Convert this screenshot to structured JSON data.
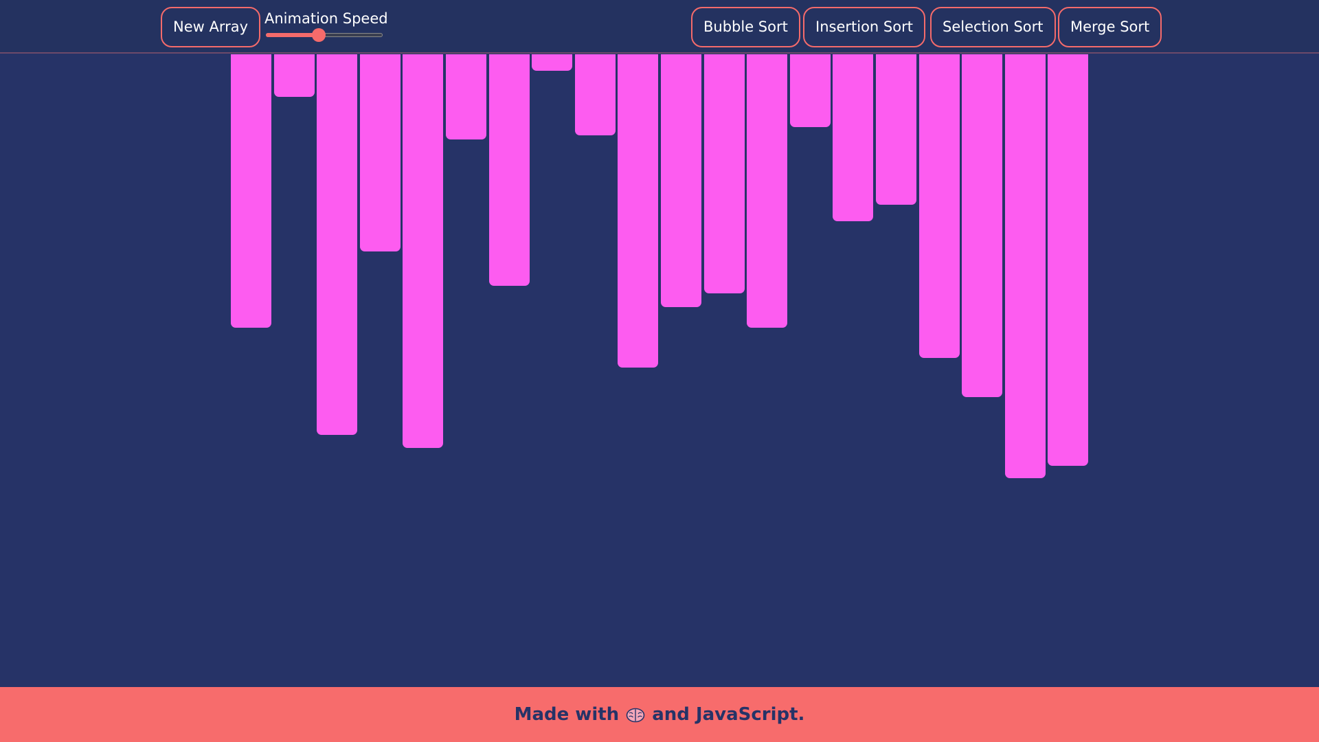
{
  "navbar": {
    "new_array_label": "New Array",
    "speed_label": "Animation Speed",
    "speed_value": 0.45,
    "bubble_label": "Bubble Sort",
    "insertion_label": "Insertion Sort",
    "selection_label": "Selection Sort",
    "merge_label": "Merge Sort"
  },
  "array": {
    "values": [
      398,
      62,
      554,
      287,
      573,
      124,
      337,
      24,
      118,
      456,
      368,
      348,
      398,
      106,
      243,
      219,
      442,
      499,
      617,
      599
    ],
    "bar_color": "#fd5cf0"
  },
  "footer": {
    "text_before": "Made with",
    "icon": "brain-icon",
    "text_after": "and JavaScript."
  },
  "colors": {
    "background": "#263367",
    "accent": "#f76c6c",
    "bar": "#fd5cf0"
  }
}
